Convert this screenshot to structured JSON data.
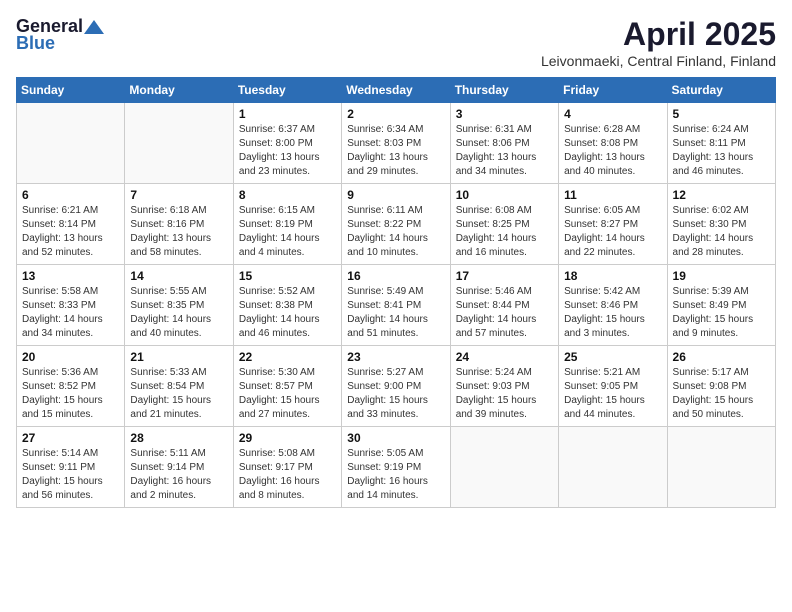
{
  "logo": {
    "general": "General",
    "blue": "Blue"
  },
  "title": "April 2025",
  "location": "Leivonmaeki, Central Finland, Finland",
  "weekdays": [
    "Sunday",
    "Monday",
    "Tuesday",
    "Wednesday",
    "Thursday",
    "Friday",
    "Saturday"
  ],
  "weeks": [
    [
      {
        "day": "",
        "info": ""
      },
      {
        "day": "",
        "info": ""
      },
      {
        "day": "1",
        "info": "Sunrise: 6:37 AM\nSunset: 8:00 PM\nDaylight: 13 hours\nand 23 minutes."
      },
      {
        "day": "2",
        "info": "Sunrise: 6:34 AM\nSunset: 8:03 PM\nDaylight: 13 hours\nand 29 minutes."
      },
      {
        "day": "3",
        "info": "Sunrise: 6:31 AM\nSunset: 8:06 PM\nDaylight: 13 hours\nand 34 minutes."
      },
      {
        "day": "4",
        "info": "Sunrise: 6:28 AM\nSunset: 8:08 PM\nDaylight: 13 hours\nand 40 minutes."
      },
      {
        "day": "5",
        "info": "Sunrise: 6:24 AM\nSunset: 8:11 PM\nDaylight: 13 hours\nand 46 minutes."
      }
    ],
    [
      {
        "day": "6",
        "info": "Sunrise: 6:21 AM\nSunset: 8:14 PM\nDaylight: 13 hours\nand 52 minutes."
      },
      {
        "day": "7",
        "info": "Sunrise: 6:18 AM\nSunset: 8:16 PM\nDaylight: 13 hours\nand 58 minutes."
      },
      {
        "day": "8",
        "info": "Sunrise: 6:15 AM\nSunset: 8:19 PM\nDaylight: 14 hours\nand 4 minutes."
      },
      {
        "day": "9",
        "info": "Sunrise: 6:11 AM\nSunset: 8:22 PM\nDaylight: 14 hours\nand 10 minutes."
      },
      {
        "day": "10",
        "info": "Sunrise: 6:08 AM\nSunset: 8:25 PM\nDaylight: 14 hours\nand 16 minutes."
      },
      {
        "day": "11",
        "info": "Sunrise: 6:05 AM\nSunset: 8:27 PM\nDaylight: 14 hours\nand 22 minutes."
      },
      {
        "day": "12",
        "info": "Sunrise: 6:02 AM\nSunset: 8:30 PM\nDaylight: 14 hours\nand 28 minutes."
      }
    ],
    [
      {
        "day": "13",
        "info": "Sunrise: 5:58 AM\nSunset: 8:33 PM\nDaylight: 14 hours\nand 34 minutes."
      },
      {
        "day": "14",
        "info": "Sunrise: 5:55 AM\nSunset: 8:35 PM\nDaylight: 14 hours\nand 40 minutes."
      },
      {
        "day": "15",
        "info": "Sunrise: 5:52 AM\nSunset: 8:38 PM\nDaylight: 14 hours\nand 46 minutes."
      },
      {
        "day": "16",
        "info": "Sunrise: 5:49 AM\nSunset: 8:41 PM\nDaylight: 14 hours\nand 51 minutes."
      },
      {
        "day": "17",
        "info": "Sunrise: 5:46 AM\nSunset: 8:44 PM\nDaylight: 14 hours\nand 57 minutes."
      },
      {
        "day": "18",
        "info": "Sunrise: 5:42 AM\nSunset: 8:46 PM\nDaylight: 15 hours\nand 3 minutes."
      },
      {
        "day": "19",
        "info": "Sunrise: 5:39 AM\nSunset: 8:49 PM\nDaylight: 15 hours\nand 9 minutes."
      }
    ],
    [
      {
        "day": "20",
        "info": "Sunrise: 5:36 AM\nSunset: 8:52 PM\nDaylight: 15 hours\nand 15 minutes."
      },
      {
        "day": "21",
        "info": "Sunrise: 5:33 AM\nSunset: 8:54 PM\nDaylight: 15 hours\nand 21 minutes."
      },
      {
        "day": "22",
        "info": "Sunrise: 5:30 AM\nSunset: 8:57 PM\nDaylight: 15 hours\nand 27 minutes."
      },
      {
        "day": "23",
        "info": "Sunrise: 5:27 AM\nSunset: 9:00 PM\nDaylight: 15 hours\nand 33 minutes."
      },
      {
        "day": "24",
        "info": "Sunrise: 5:24 AM\nSunset: 9:03 PM\nDaylight: 15 hours\nand 39 minutes."
      },
      {
        "day": "25",
        "info": "Sunrise: 5:21 AM\nSunset: 9:05 PM\nDaylight: 15 hours\nand 44 minutes."
      },
      {
        "day": "26",
        "info": "Sunrise: 5:17 AM\nSunset: 9:08 PM\nDaylight: 15 hours\nand 50 minutes."
      }
    ],
    [
      {
        "day": "27",
        "info": "Sunrise: 5:14 AM\nSunset: 9:11 PM\nDaylight: 15 hours\nand 56 minutes."
      },
      {
        "day": "28",
        "info": "Sunrise: 5:11 AM\nSunset: 9:14 PM\nDaylight: 16 hours\nand 2 minutes."
      },
      {
        "day": "29",
        "info": "Sunrise: 5:08 AM\nSunset: 9:17 PM\nDaylight: 16 hours\nand 8 minutes."
      },
      {
        "day": "30",
        "info": "Sunrise: 5:05 AM\nSunset: 9:19 PM\nDaylight: 16 hours\nand 14 minutes."
      },
      {
        "day": "",
        "info": ""
      },
      {
        "day": "",
        "info": ""
      },
      {
        "day": "",
        "info": ""
      }
    ]
  ]
}
